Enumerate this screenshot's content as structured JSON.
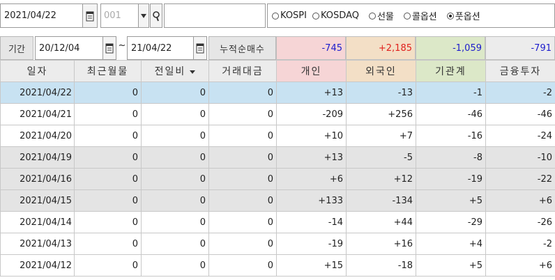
{
  "toolbar": {
    "date": "2021/04/22",
    "code": "001",
    "search_text": "",
    "markets": [
      {
        "label": "KOSPI",
        "selected": false
      },
      {
        "label": "KOSDAQ",
        "selected": false
      },
      {
        "label": "선물",
        "selected": false
      },
      {
        "label": "콜옵션",
        "selected": false
      },
      {
        "label": "풋옵션",
        "selected": true
      }
    ]
  },
  "period": {
    "label": "기간",
    "start": "20/12/04",
    "separator": "~",
    "end": "21/04/22",
    "cum_label": "누적순매수",
    "totals": {
      "individual": "-745",
      "foreign": "+2,185",
      "institution": "-1,059",
      "financial": "-791"
    }
  },
  "table": {
    "headers": [
      "일자",
      "최근월물",
      "전일비",
      "거래대금",
      "개인",
      "외국인",
      "기관계",
      "금융투자"
    ],
    "rows": [
      {
        "date": "2021/04/22",
        "near": "0",
        "prev": "0",
        "amount": "0",
        "individual": "+13",
        "foreign": "-13",
        "institution": "-1",
        "financial": "-2",
        "style": "sel"
      },
      {
        "date": "2021/04/21",
        "near": "0",
        "prev": "0",
        "amount": "0",
        "individual": "-209",
        "foreign": "+256",
        "institution": "-46",
        "financial": "-46",
        "style": ""
      },
      {
        "date": "2021/04/20",
        "near": "0",
        "prev": "0",
        "amount": "0",
        "individual": "+10",
        "foreign": "+7",
        "institution": "-16",
        "financial": "-24",
        "style": ""
      },
      {
        "date": "2021/04/19",
        "near": "0",
        "prev": "0",
        "amount": "0",
        "individual": "+13",
        "foreign": "-5",
        "institution": "-8",
        "financial": "-10",
        "style": "gray"
      },
      {
        "date": "2021/04/16",
        "near": "0",
        "prev": "0",
        "amount": "0",
        "individual": "+6",
        "foreign": "+12",
        "institution": "-19",
        "financial": "-22",
        "style": "gray"
      },
      {
        "date": "2021/04/15",
        "near": "0",
        "prev": "0",
        "amount": "0",
        "individual": "+133",
        "foreign": "-134",
        "institution": "+5",
        "financial": "+6",
        "style": "gray"
      },
      {
        "date": "2021/04/14",
        "near": "0",
        "prev": "0",
        "amount": "0",
        "individual": "-14",
        "foreign": "+44",
        "institution": "-29",
        "financial": "-26",
        "style": ""
      },
      {
        "date": "2021/04/13",
        "near": "0",
        "prev": "0",
        "amount": "0",
        "individual": "-19",
        "foreign": "+16",
        "institution": "+4",
        "financial": "-2",
        "style": ""
      },
      {
        "date": "2021/04/12",
        "near": "0",
        "prev": "0",
        "amount": "0",
        "individual": "+15",
        "foreign": "-18",
        "institution": "+5",
        "financial": "+6",
        "style": ""
      }
    ]
  },
  "colors": {
    "positive": "#e0201c",
    "negative": "#1c1ccc",
    "selected_row": "#c8e2f2",
    "gray_row": "#e4e4e4"
  }
}
